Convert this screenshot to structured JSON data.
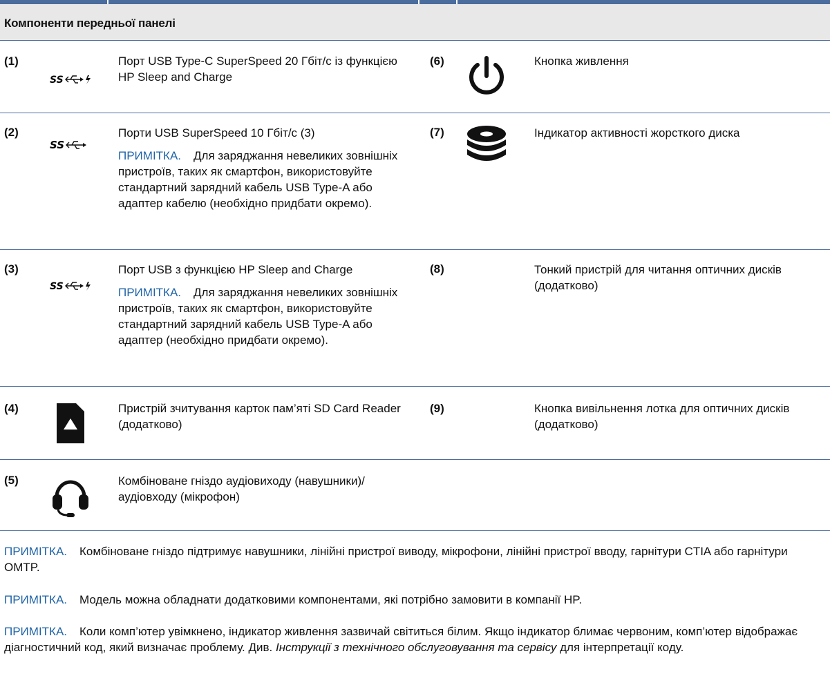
{
  "header": {
    "title": "Компоненти передньої панелі"
  },
  "rows": [
    {
      "left": {
        "number": "(1)",
        "icon": "usb-superspeed-charge-icon",
        "text": "Порт USB Type-C SuperSpeed 20 Гбіт/с із функцією HP Sleep and Charge"
      },
      "right": {
        "number": "(6)",
        "icon": "power-icon",
        "text": "Кнопка живлення"
      }
    },
    {
      "left": {
        "number": "(2)",
        "icon": "usb-superspeed-icon",
        "text": "Порти USB SuperSpeed 10 Гбіт/с (3)",
        "note_label": "ПРИМІТКА.",
        "note": "Для заряджання невеликих зовнішніх пристроїв, таких як смартфон, використовуйте стандартний зарядний кабель USB Type-A або адаптер кабелю (необхідно придбати окремо)."
      },
      "right": {
        "number": "(7)",
        "icon": "hard-drive-activity-icon",
        "text": "Індикатор активності жорсткого диска"
      }
    },
    {
      "left": {
        "number": "(3)",
        "icon": "usb-superspeed-charge-icon",
        "text": "Порт USB з функцією HP Sleep and Charge",
        "note_label": "ПРИМІТКА.",
        "note": "Для заряджання невеликих зовнішніх пристроїв, таких як смартфон, використовуйте стандартний зарядний кабель USB Type-A або адаптер (необхідно придбати окремо)."
      },
      "right": {
        "number": "(8)",
        "text": "Тонкий пристрій для читання оптичних дисків (додатково)"
      }
    },
    {
      "left": {
        "number": "(4)",
        "icon": "sd-card-icon",
        "text": "Пристрій зчитування карток пам’яті SD Card Reader (додатково)"
      },
      "right": {
        "number": "(9)",
        "text": "Кнопка вивільнення лотка для оптичних дисків (додатково)"
      }
    },
    {
      "left": {
        "number": "(5)",
        "icon": "headset-icon",
        "text": "Комбіноване гніздо аудіовиходу (навушники)/ аудіовходу (мікрофон)"
      }
    }
  ],
  "icon_text": {
    "ss": "SS"
  },
  "notes": [
    {
      "label": "ПРИМІТКА.",
      "text": "Комбіноване гніздо підтримує навушники, лінійні пристрої виводу, мікрофони, лінійні пристрої вводу, гарнітури CTIA або гарнітури OMTP."
    },
    {
      "label": "ПРИМІТКА.",
      "text": "Модель можна обладнати додатковими компонентами, які потрібно замовити в компанії HP."
    },
    {
      "label": "ПРИМІТКА.",
      "text_before": "Коли комп’ютер увімкнено, індикатор живлення зазвичай світиться білим. Якщо індикатор блимає червоним, комп’ютер відображає діагностичний код, який визначає проблему. Див.",
      "text_italic": "Інструкції з технічного обслуговування та сервісу",
      "text_after": "для інтерпретації коду."
    }
  ],
  "colors": {
    "accent": "#4a6d9e",
    "note_label": "#1f64a8",
    "header_bg": "#e8e8e8"
  }
}
